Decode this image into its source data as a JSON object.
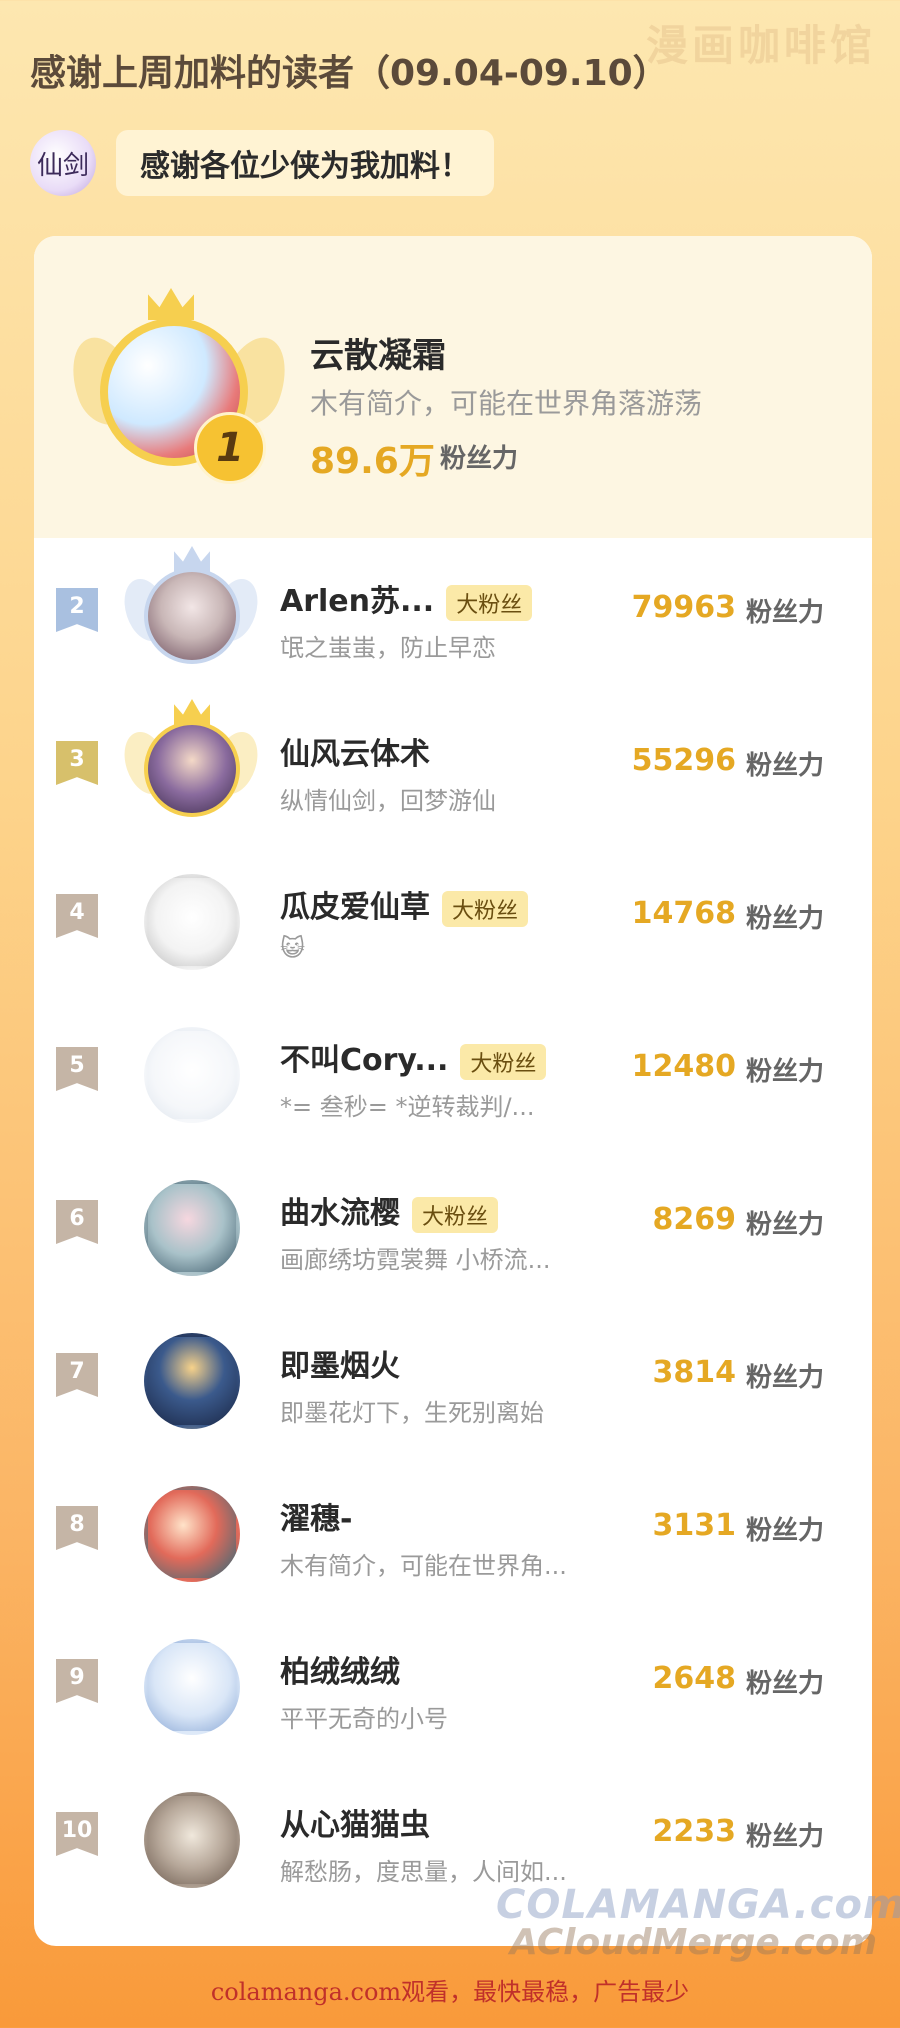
{
  "watermark_top": "漫画咖啡馆",
  "heading": "感谢上周加料的读者（09.04-09.10）",
  "logo_text": "仙剑",
  "bubble_text": "感谢各位少侠为我加料！",
  "unit_label": "粉丝力",
  "top": {
    "rank": "1",
    "name": "云散凝霜",
    "sub": "木有简介，可能在世界角落游荡",
    "points": "89.6万"
  },
  "rows": [
    {
      "rank": "2",
      "name": "Arlen苏...",
      "tag": "大粉丝",
      "sub": "氓之蚩蚩，防止早恋",
      "points": "79963"
    },
    {
      "rank": "3",
      "name": "仙风云体术",
      "tag": "",
      "sub": "纵情仙剑，回梦游仙",
      "points": "55296"
    },
    {
      "rank": "4",
      "name": "瓜皮爱仙草",
      "tag": "大粉丝",
      "sub": "😺",
      "points": "14768"
    },
    {
      "rank": "5",
      "name": "不叫Cory...",
      "tag": "大粉丝",
      "sub": "*= 叁秒= *逆转裁判/...",
      "points": "12480"
    },
    {
      "rank": "6",
      "name": "曲水流樱",
      "tag": "大粉丝",
      "sub": "画廊绣坊霓裳舞 小桥流...",
      "points": "8269"
    },
    {
      "rank": "7",
      "name": "即墨烟火",
      "tag": "",
      "sub": "即墨花灯下，生死别离始",
      "points": "3814"
    },
    {
      "rank": "8",
      "name": "濯穗-",
      "tag": "",
      "sub": "木有简介，可能在世界角...",
      "points": "3131"
    },
    {
      "rank": "9",
      "name": "柏绒绒绒",
      "tag": "",
      "sub": "平平无奇的小号",
      "points": "2648"
    },
    {
      "rank": "10",
      "name": "从心猫猫虫",
      "tag": "",
      "sub": "解愁肠，度思量，人间如...",
      "points": "2233"
    }
  ],
  "watermark_mid": "COLAMANGA.com",
  "watermark_mid2": "ACloudMerge.com",
  "footer": "colamanga.com观看，最快最稳，广告最少",
  "colors": {
    "accent": "#e5a823",
    "tag_bg": "#fbe9a8",
    "footer": "#c0302a"
  }
}
